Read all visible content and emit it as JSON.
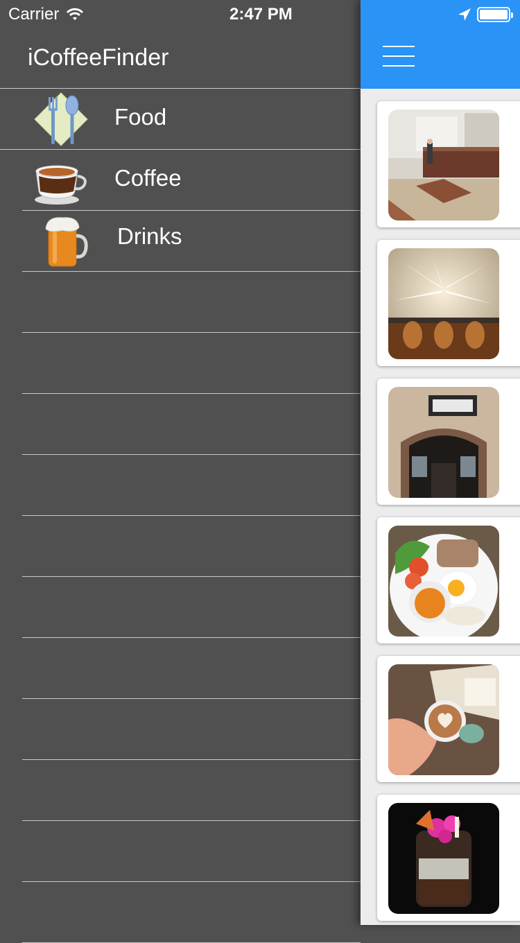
{
  "status_bar": {
    "carrier": "Carrier",
    "time": "2:47 PM"
  },
  "drawer": {
    "title": "iCoffeeFinder",
    "items": [
      {
        "label": "Food",
        "icon": "fork-spoon-icon"
      },
      {
        "label": "Coffee",
        "icon": "coffee-cup-icon"
      },
      {
        "label": "Drinks",
        "icon": "beer-mug-icon"
      }
    ]
  },
  "main": {
    "navbar": {
      "menu_icon": "hamburger-menu-icon",
      "color": "#2a93f6"
    }
  },
  "colors": {
    "drawer_bg": "#505050",
    "navbar": "#2a93f6",
    "separator": "#c8c8c8"
  }
}
